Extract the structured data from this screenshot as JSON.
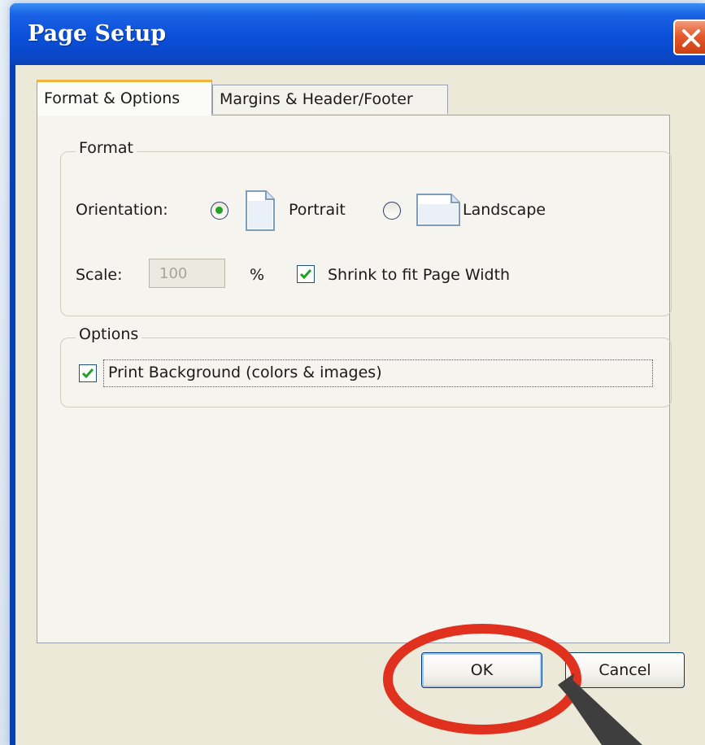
{
  "window": {
    "title": "Page Setup"
  },
  "tabs": [
    {
      "label": "Format & Options",
      "active": true
    },
    {
      "label": "Margins & Header/Footer",
      "active": false
    }
  ],
  "format_group": {
    "legend": "Format",
    "orientation_label": "Orientation:",
    "portrait_label": "Portrait",
    "landscape_label": "Landscape",
    "selected_orientation": "Portrait",
    "scale_label": "Scale:",
    "scale_value": "100",
    "percent_sign": "%",
    "shrink_label": "Shrink to fit Page Width",
    "shrink_checked": true
  },
  "options_group": {
    "legend": "Options",
    "print_background_label": "Print Background (colors & images)",
    "print_background_checked": true
  },
  "buttons": {
    "ok_label": "OK",
    "cancel_label": "Cancel"
  },
  "colors": {
    "title_bar": "#0b4fd9",
    "close_button": "#e35b2c",
    "highlight_ellipse": "#e0301e",
    "check_mark": "#21a121"
  },
  "icons": {
    "close": "close-icon",
    "portrait": "portrait-page-icon",
    "landscape": "landscape-page-icon"
  }
}
